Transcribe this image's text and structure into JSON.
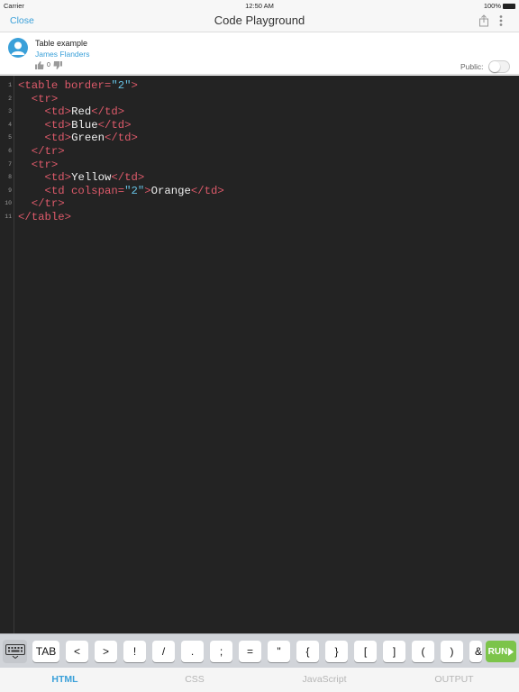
{
  "status_bar": {
    "carrier": "Carrier",
    "time": "12:50 AM",
    "battery": "100%"
  },
  "nav": {
    "close_label": "Close",
    "title": "Code Playground"
  },
  "project": {
    "title": "Table example",
    "author": "James Flanders",
    "votes": "0",
    "public_label": "Public:",
    "public_on": false
  },
  "editor": {
    "line_numbers": [
      "1",
      "2",
      "3",
      "4",
      "5",
      "6",
      "7",
      "8",
      "9",
      "10",
      "11"
    ],
    "lines": [
      "<table border=\"2\">",
      "  <tr>",
      "    <td>Red</td>",
      "    <td>Blue</td>",
      "    <td>Green</td>",
      "  </tr>",
      "  <tr>",
      "    <td>Yellow</td>",
      "    <td colspan=\"2\">Orange</td>",
      "  </tr>",
      "</table>"
    ]
  },
  "keyboard_bar": {
    "keys": [
      "TAB",
      "<",
      ">",
      "!",
      "/",
      ".",
      ";",
      "=",
      "\"",
      "{",
      "}",
      "[",
      "]",
      "(",
      ")",
      "&"
    ],
    "run_label": "RUN"
  },
  "tabs": [
    "HTML",
    "CSS",
    "JavaScript",
    "OUTPUT"
  ],
  "active_tab": "HTML",
  "colors": {
    "accent": "#3aa0d9",
    "run": "#7cc44a",
    "editor_bg": "#232323",
    "tag": "#dd5a6a",
    "string": "#66c0e2"
  }
}
